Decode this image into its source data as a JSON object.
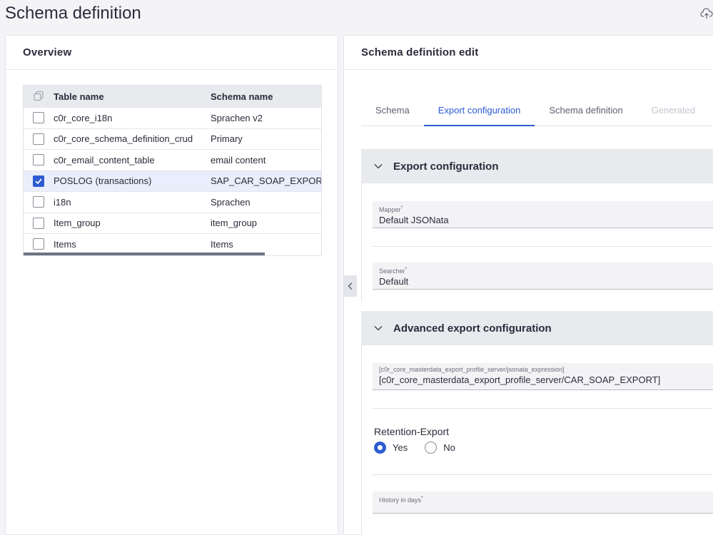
{
  "page": {
    "title": "Schema definition"
  },
  "overview": {
    "title": "Overview",
    "columns": {
      "table_name": "Table name",
      "schema_name": "Schema name"
    },
    "rows": [
      {
        "table": "c0r_core_i18n",
        "schema": "Sprachen v2",
        "checked": false
      },
      {
        "table": "c0r_core_schema_definition_crud",
        "schema": "Primary",
        "checked": false
      },
      {
        "table": "c0r_email_content_table",
        "schema": "email content",
        "checked": false
      },
      {
        "table": "POSLOG (transactions)",
        "schema": "SAP_CAR_SOAP_EXPORT",
        "checked": true
      },
      {
        "table": "i18n",
        "schema": "Sprachen",
        "checked": false
      },
      {
        "table": "Item_group",
        "schema": "item_group",
        "checked": false
      },
      {
        "table": "Items",
        "schema": "Items",
        "checked": false
      }
    ]
  },
  "edit": {
    "title": "Schema definition edit",
    "tabs": [
      {
        "label": "Schema",
        "state": "normal"
      },
      {
        "label": "Export configuration",
        "state": "active"
      },
      {
        "label": "Schema definition",
        "state": "normal"
      },
      {
        "label": "Generated",
        "state": "disabled"
      }
    ],
    "export_section": {
      "title": "Export configuration",
      "mapper": {
        "label": "Mapper",
        "required": "*",
        "value": "Default JSONata"
      },
      "searcher": {
        "label": "Searcher",
        "required": "*",
        "value": "Default"
      }
    },
    "advanced_section": {
      "title": "Advanced export configuration",
      "expression": {
        "label": "[c0r_core_masterdata_export_profile_server/jsonata_expression]",
        "value": "[c0r_core_masterdata_export_profile_server/CAR_SOAP_EXPORT]"
      },
      "retention": {
        "title": "Retention-Export",
        "yes": "Yes",
        "no": "No",
        "selected": "yes"
      },
      "history": {
        "label": "History in days",
        "required": "*",
        "value": ""
      }
    }
  },
  "colors": {
    "accent": "#2d5bd1",
    "header_bg": "#e9eaee",
    "selected_row": "#e8eefb"
  }
}
